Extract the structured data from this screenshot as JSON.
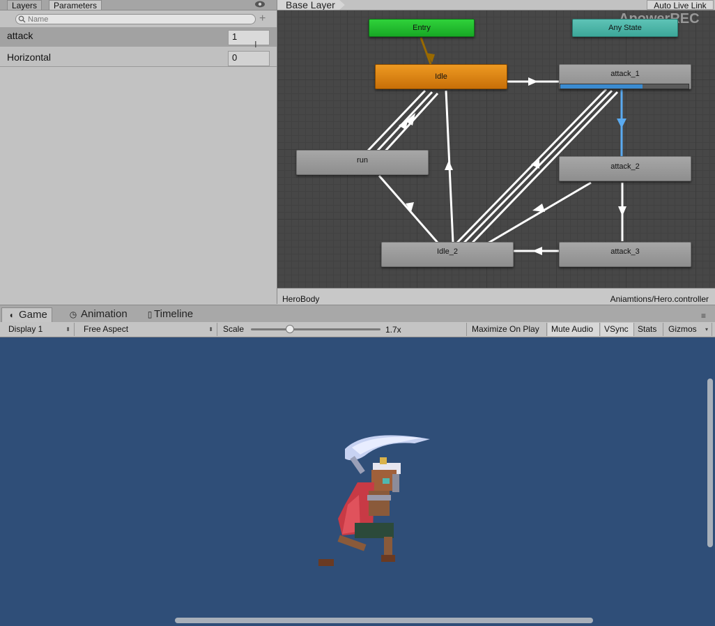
{
  "left_panel": {
    "tabs": [
      {
        "label": "Layers",
        "active": false
      },
      {
        "label": "Parameters",
        "active": true
      }
    ],
    "search_placeholder": "Name",
    "parameters": [
      {
        "name": "attack",
        "value": "1"
      },
      {
        "name": "Horizontal",
        "value": "0"
      }
    ]
  },
  "graph": {
    "breadcrumb": "Base Layer",
    "auto_live_link": "Auto Live Link",
    "watermark": "ApowerREC",
    "states": {
      "entry": "Entry",
      "any_state": "Any State",
      "idle": "Idle",
      "attack_1": "attack_1",
      "attack_2": "attack_2",
      "attack_3": "attack_3",
      "run": "run",
      "idle_2": "Idle_2"
    },
    "attack_1_progress": 0.64,
    "footer_left": "HeroBody",
    "footer_right": "Aniamtions/Hero.controller",
    "colors": {
      "default_state": "#e8901a",
      "entry": "#23c12f",
      "any_state": "#4cb7a9",
      "active_transition": "#5aaaf0"
    }
  },
  "bottom_tabs": [
    {
      "label": "Game",
      "icon": "pacman-icon",
      "active": true
    },
    {
      "label": "Animation",
      "icon": "clock-icon",
      "active": false
    },
    {
      "label": "Timeline",
      "icon": "timeline-icon",
      "active": false
    }
  ],
  "toolbar": {
    "display": "Display 1",
    "aspect": "Free Aspect",
    "scale_label": "Scale",
    "scale_value": "1.7x",
    "scale_fraction": 0.3,
    "maximize_on_play": "Maximize On Play",
    "mute_audio": "Mute Audio",
    "vsync": "VSync",
    "stats": "Stats",
    "gizmos": "Gizmos"
  },
  "viewport": {
    "background": "#2f4e78"
  }
}
